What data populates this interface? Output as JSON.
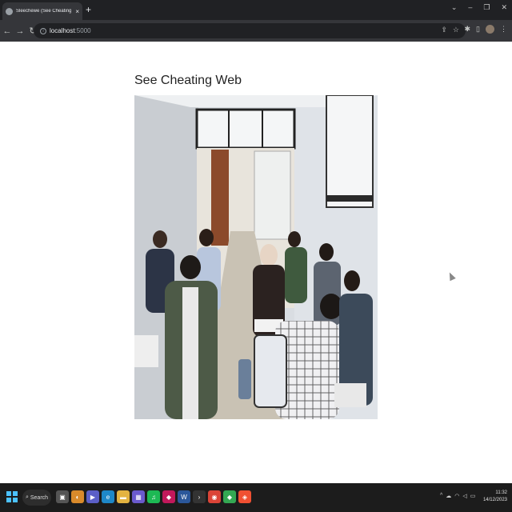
{
  "browser": {
    "tab": {
      "title": "Sleechewe (See Cheating Web)",
      "close": "×",
      "new_tab": "+"
    },
    "window_controls": [
      "⌄",
      "–",
      "❐",
      "✕"
    ],
    "nav": {
      "back": "←",
      "forward": "→",
      "reload": "↻"
    },
    "url": {
      "host": "localhost",
      "port": ":5000"
    },
    "omnibox_icons": [
      "share-icon",
      "star-icon"
    ],
    "toolbar_icons": [
      "extensions-icon",
      "sidepanel-icon",
      "profile-avatar",
      "menu-icon"
    ]
  },
  "page": {
    "heading": "See Cheating Web",
    "camera_feed": "classroom-camera-feed"
  },
  "taskbar": {
    "search_label": "Search",
    "apps": [
      {
        "name": "task-view-icon",
        "glyph": "▣",
        "color": "#555555"
      },
      {
        "name": "explorer-widget-icon",
        "glyph": "◐",
        "color": "#d98a2b"
      },
      {
        "name": "chat-icon",
        "glyph": "▶",
        "color": "#5b5fc7"
      },
      {
        "name": "edge-icon",
        "glyph": "e",
        "color": "#1e88c8"
      },
      {
        "name": "file-explorer-icon",
        "glyph": "▬",
        "color": "#e3b341"
      },
      {
        "name": "calculator-icon",
        "glyph": "▦",
        "color": "#6a5acd"
      },
      {
        "name": "spotify-icon",
        "glyph": "♫",
        "color": "#1db954"
      },
      {
        "name": "store-icon",
        "glyph": "◆",
        "color": "#c2185b"
      },
      {
        "name": "word-icon",
        "glyph": "W",
        "color": "#2b579a"
      },
      {
        "name": "terminal-icon",
        "glyph": "›",
        "color": "#333333"
      },
      {
        "name": "chrome-icon",
        "glyph": "◉",
        "color": "#db4437"
      },
      {
        "name": "maps-icon",
        "glyph": "◆",
        "color": "#34a853"
      },
      {
        "name": "git-icon",
        "glyph": "◈",
        "color": "#f05032"
      }
    ],
    "tray_icons": [
      "^",
      "☁",
      "☁",
      "📶",
      "🔊",
      "🔋"
    ],
    "time": "11:32",
    "date": "14/12/2023"
  }
}
